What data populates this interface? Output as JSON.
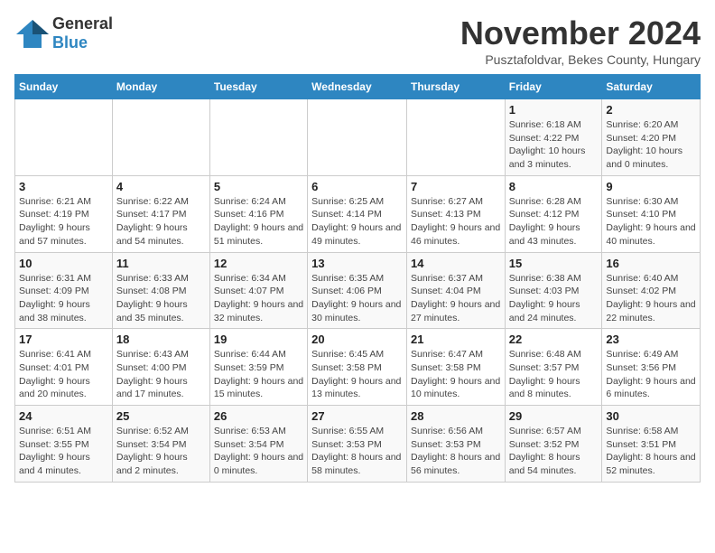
{
  "logo": {
    "general": "General",
    "blue": "Blue"
  },
  "title": "November 2024",
  "subtitle": "Pusztafoldvar, Bekes County, Hungary",
  "days_of_week": [
    "Sunday",
    "Monday",
    "Tuesday",
    "Wednesday",
    "Thursday",
    "Friday",
    "Saturday"
  ],
  "weeks": [
    [
      {
        "day": "",
        "info": ""
      },
      {
        "day": "",
        "info": ""
      },
      {
        "day": "",
        "info": ""
      },
      {
        "day": "",
        "info": ""
      },
      {
        "day": "",
        "info": ""
      },
      {
        "day": "1",
        "info": "Sunrise: 6:18 AM\nSunset: 4:22 PM\nDaylight: 10 hours and 3 minutes."
      },
      {
        "day": "2",
        "info": "Sunrise: 6:20 AM\nSunset: 4:20 PM\nDaylight: 10 hours and 0 minutes."
      }
    ],
    [
      {
        "day": "3",
        "info": "Sunrise: 6:21 AM\nSunset: 4:19 PM\nDaylight: 9 hours and 57 minutes."
      },
      {
        "day": "4",
        "info": "Sunrise: 6:22 AM\nSunset: 4:17 PM\nDaylight: 9 hours and 54 minutes."
      },
      {
        "day": "5",
        "info": "Sunrise: 6:24 AM\nSunset: 4:16 PM\nDaylight: 9 hours and 51 minutes."
      },
      {
        "day": "6",
        "info": "Sunrise: 6:25 AM\nSunset: 4:14 PM\nDaylight: 9 hours and 49 minutes."
      },
      {
        "day": "7",
        "info": "Sunrise: 6:27 AM\nSunset: 4:13 PM\nDaylight: 9 hours and 46 minutes."
      },
      {
        "day": "8",
        "info": "Sunrise: 6:28 AM\nSunset: 4:12 PM\nDaylight: 9 hours and 43 minutes."
      },
      {
        "day": "9",
        "info": "Sunrise: 6:30 AM\nSunset: 4:10 PM\nDaylight: 9 hours and 40 minutes."
      }
    ],
    [
      {
        "day": "10",
        "info": "Sunrise: 6:31 AM\nSunset: 4:09 PM\nDaylight: 9 hours and 38 minutes."
      },
      {
        "day": "11",
        "info": "Sunrise: 6:33 AM\nSunset: 4:08 PM\nDaylight: 9 hours and 35 minutes."
      },
      {
        "day": "12",
        "info": "Sunrise: 6:34 AM\nSunset: 4:07 PM\nDaylight: 9 hours and 32 minutes."
      },
      {
        "day": "13",
        "info": "Sunrise: 6:35 AM\nSunset: 4:06 PM\nDaylight: 9 hours and 30 minutes."
      },
      {
        "day": "14",
        "info": "Sunrise: 6:37 AM\nSunset: 4:04 PM\nDaylight: 9 hours and 27 minutes."
      },
      {
        "day": "15",
        "info": "Sunrise: 6:38 AM\nSunset: 4:03 PM\nDaylight: 9 hours and 24 minutes."
      },
      {
        "day": "16",
        "info": "Sunrise: 6:40 AM\nSunset: 4:02 PM\nDaylight: 9 hours and 22 minutes."
      }
    ],
    [
      {
        "day": "17",
        "info": "Sunrise: 6:41 AM\nSunset: 4:01 PM\nDaylight: 9 hours and 20 minutes."
      },
      {
        "day": "18",
        "info": "Sunrise: 6:43 AM\nSunset: 4:00 PM\nDaylight: 9 hours and 17 minutes."
      },
      {
        "day": "19",
        "info": "Sunrise: 6:44 AM\nSunset: 3:59 PM\nDaylight: 9 hours and 15 minutes."
      },
      {
        "day": "20",
        "info": "Sunrise: 6:45 AM\nSunset: 3:58 PM\nDaylight: 9 hours and 13 minutes."
      },
      {
        "day": "21",
        "info": "Sunrise: 6:47 AM\nSunset: 3:58 PM\nDaylight: 9 hours and 10 minutes."
      },
      {
        "day": "22",
        "info": "Sunrise: 6:48 AM\nSunset: 3:57 PM\nDaylight: 9 hours and 8 minutes."
      },
      {
        "day": "23",
        "info": "Sunrise: 6:49 AM\nSunset: 3:56 PM\nDaylight: 9 hours and 6 minutes."
      }
    ],
    [
      {
        "day": "24",
        "info": "Sunrise: 6:51 AM\nSunset: 3:55 PM\nDaylight: 9 hours and 4 minutes."
      },
      {
        "day": "25",
        "info": "Sunrise: 6:52 AM\nSunset: 3:54 PM\nDaylight: 9 hours and 2 minutes."
      },
      {
        "day": "26",
        "info": "Sunrise: 6:53 AM\nSunset: 3:54 PM\nDaylight: 9 hours and 0 minutes."
      },
      {
        "day": "27",
        "info": "Sunrise: 6:55 AM\nSunset: 3:53 PM\nDaylight: 8 hours and 58 minutes."
      },
      {
        "day": "28",
        "info": "Sunrise: 6:56 AM\nSunset: 3:53 PM\nDaylight: 8 hours and 56 minutes."
      },
      {
        "day": "29",
        "info": "Sunrise: 6:57 AM\nSunset: 3:52 PM\nDaylight: 8 hours and 54 minutes."
      },
      {
        "day": "30",
        "info": "Sunrise: 6:58 AM\nSunset: 3:51 PM\nDaylight: 8 hours and 52 minutes."
      }
    ]
  ]
}
